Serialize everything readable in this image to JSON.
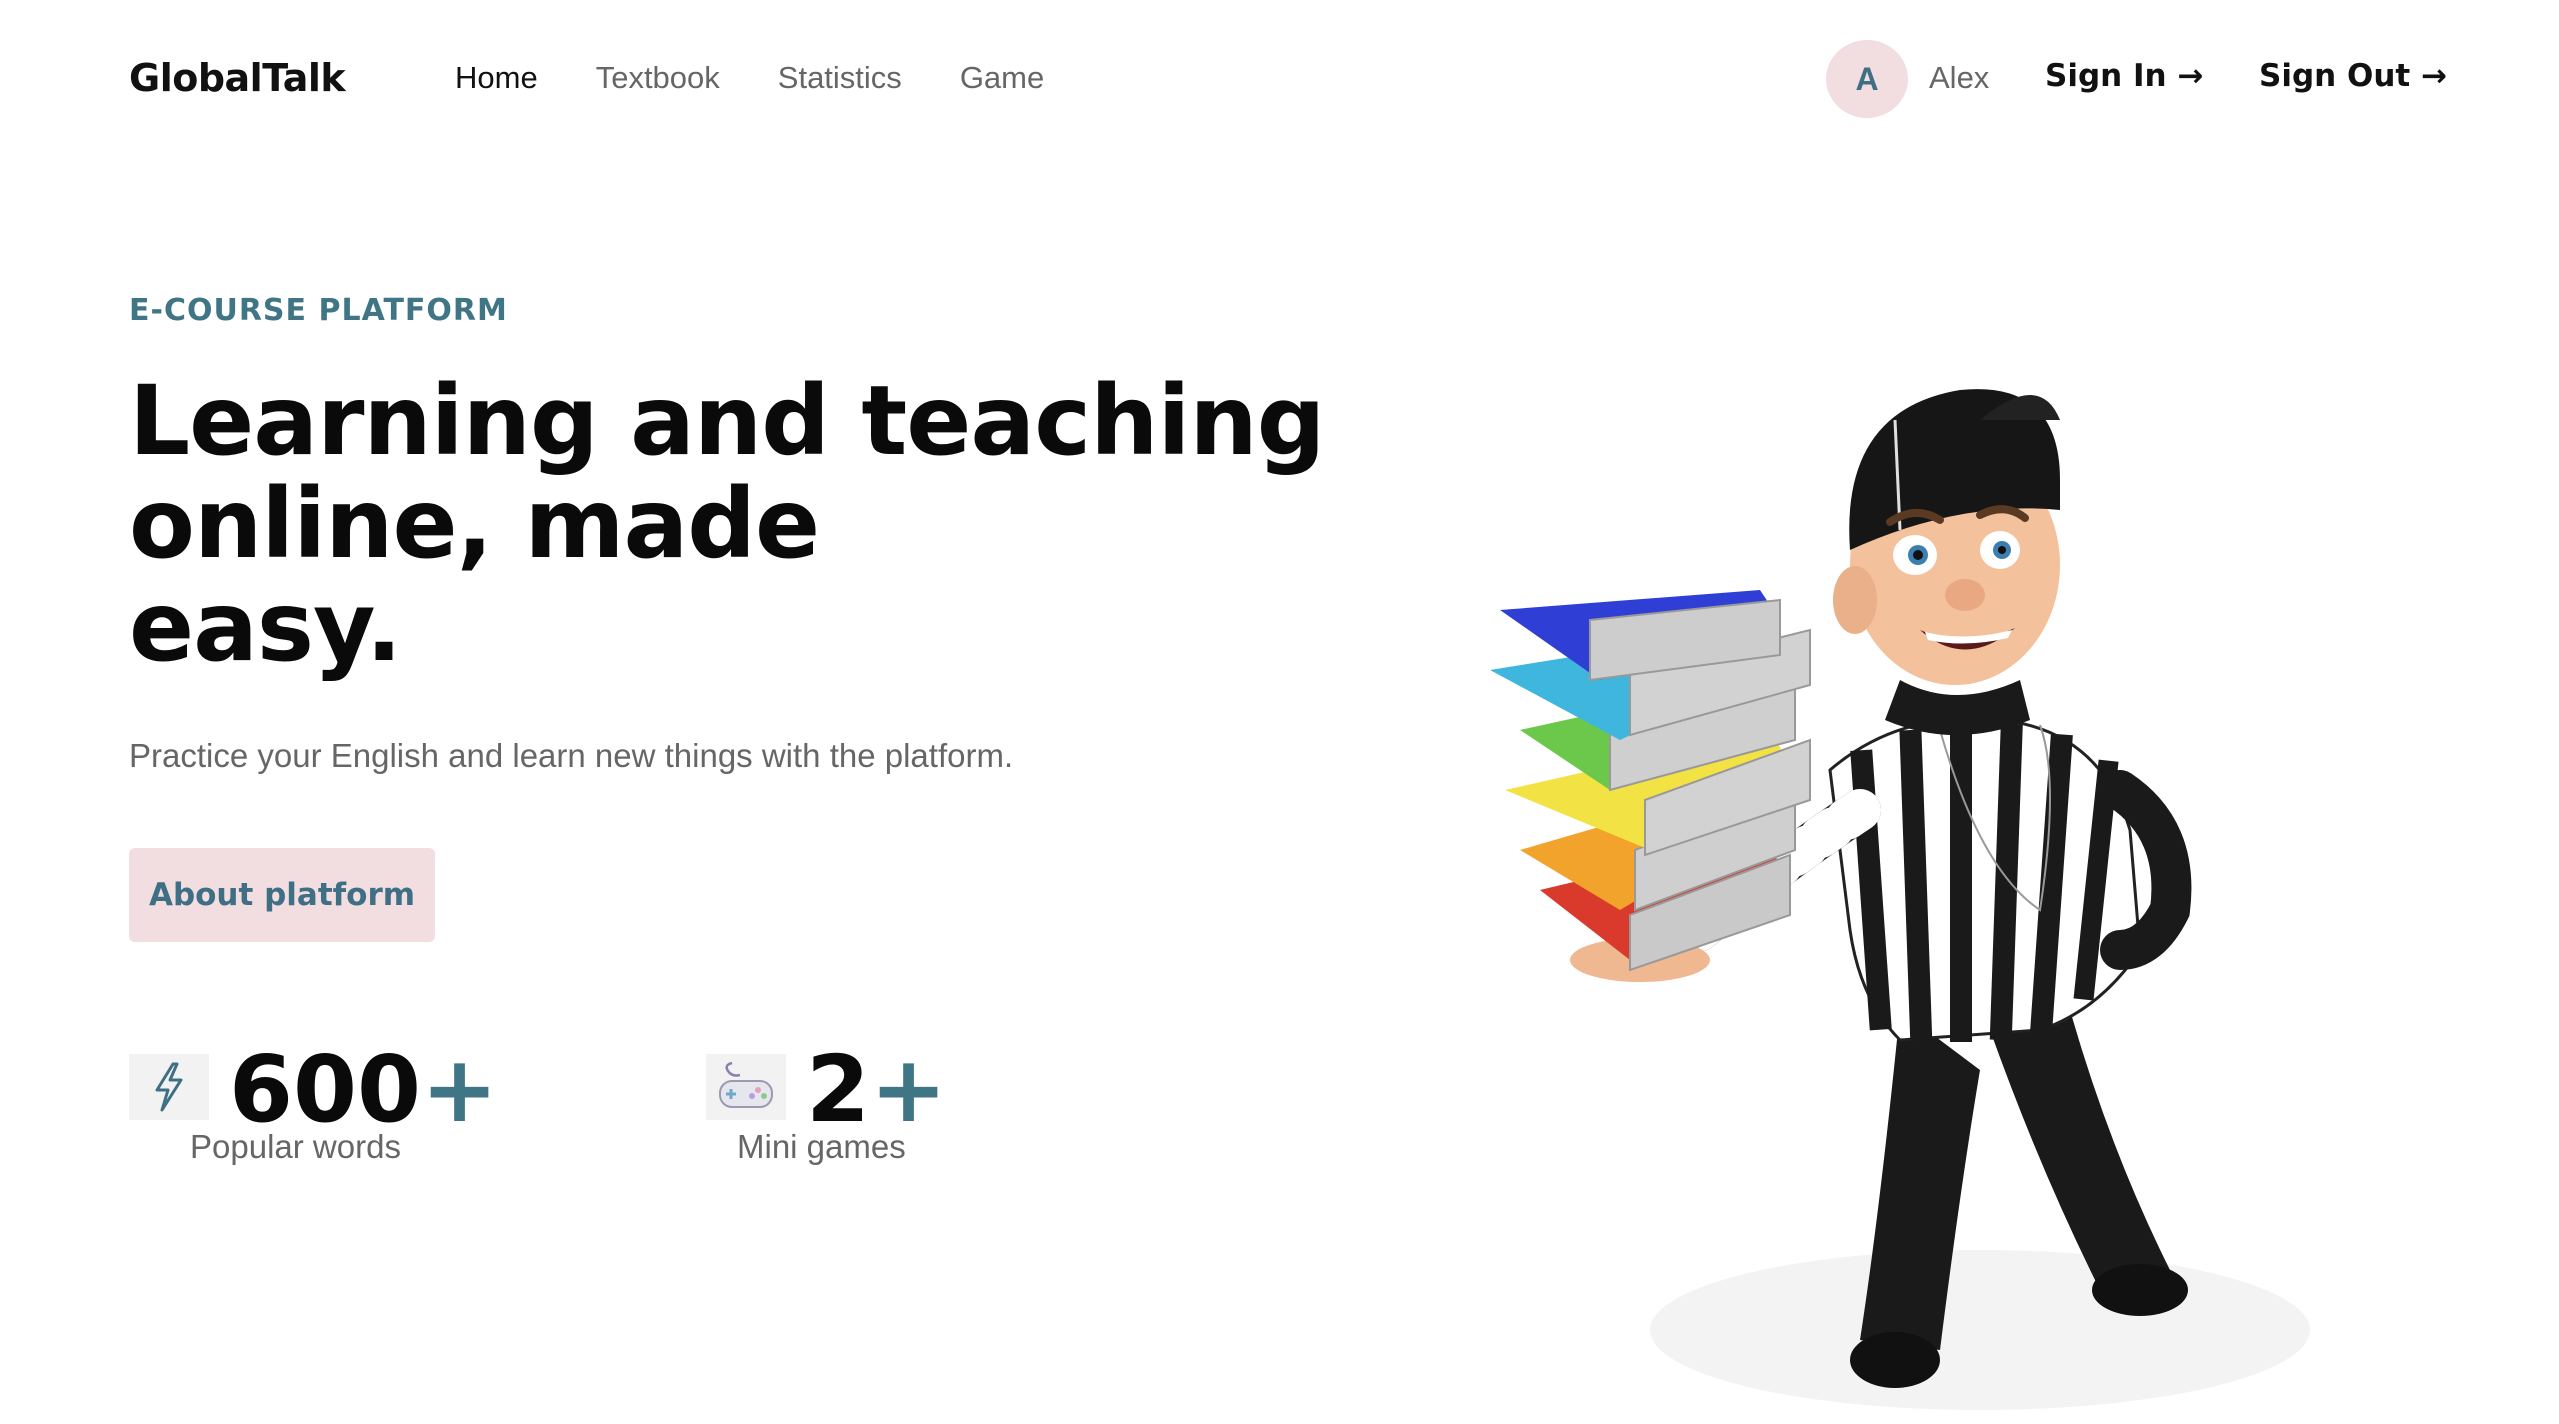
{
  "header": {
    "logo": "GlobalTalk",
    "nav": [
      {
        "label": "Home",
        "active": true
      },
      {
        "label": "Textbook",
        "active": false
      },
      {
        "label": "Statistics",
        "active": false
      },
      {
        "label": "Game",
        "active": false
      }
    ],
    "user": {
      "avatar_letter": "A",
      "name": "Alex"
    },
    "sign_in": "Sign In →",
    "sign_out": "Sign Out →"
  },
  "hero": {
    "eyebrow": "E-COURSE PLATFORM",
    "title_lines": [
      "Learning and teaching",
      "online, made",
      "easy."
    ],
    "subtitle": "Practice your English and learn new things with the platform.",
    "cta": "About platform"
  },
  "stats": [
    {
      "icon": "lightning-icon",
      "number": "600",
      "suffix": "+",
      "label": "Popular words"
    },
    {
      "icon": "gamepad-icon",
      "number": "2",
      "suffix": "+",
      "label": "Mini games"
    }
  ],
  "colors": {
    "accent": "#3f7585",
    "button_bg": "#f2dde0",
    "text_muted": "#666666"
  },
  "illustration": {
    "icon": "referee-with-books-illustration"
  }
}
